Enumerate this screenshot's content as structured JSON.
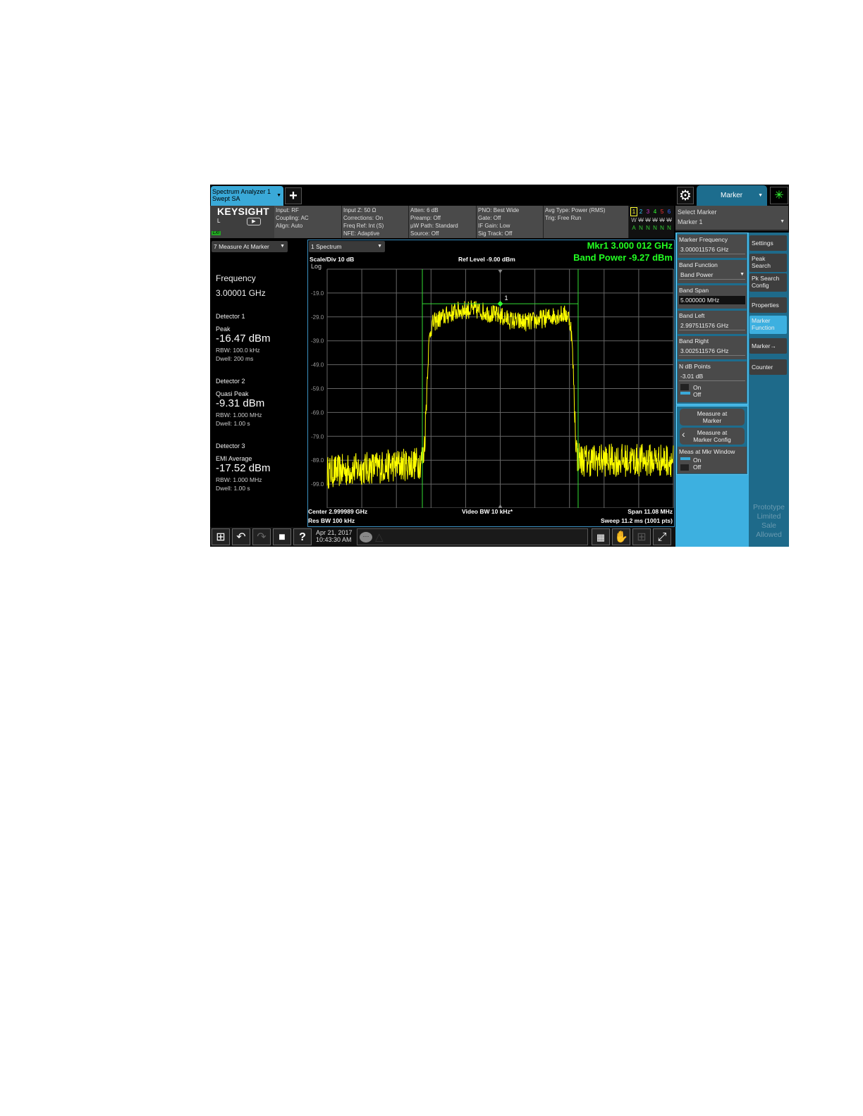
{
  "tabs": {
    "instrument_line1": "Spectrum Analyzer 1",
    "instrument_line2": "Swept SA",
    "add_icon": "plus-icon"
  },
  "menu": {
    "settings_icon": "gear-icon",
    "active_menu": "Marker",
    "status_icon": "busy-spinner-icon"
  },
  "brand": {
    "logo": "KEYSIGHT",
    "input_indicator": "L",
    "lxi": "LXI"
  },
  "settings": [
    [
      "Input: RF",
      "Coupling: AC",
      "Align: Auto",
      ""
    ],
    [
      "Input Z: 50 Ω",
      "Corrections: On",
      "Freq Ref: Int (S)",
      "NFE: Adaptive"
    ],
    [
      "Atten: 6 dB",
      "Preamp: Off",
      "µW Path: Standard",
      "Source: Off"
    ],
    [
      "PNO: Best Wide",
      "Gate: Off",
      "IF Gain: Low",
      "Sig Track: Off"
    ],
    [
      "Avg Type: Power (RMS)",
      "Trig: Free Run",
      "",
      ""
    ]
  ],
  "traces": {
    "numbers": [
      "1",
      "2",
      "3",
      "4",
      "5",
      "6"
    ],
    "colors": [
      "#ffff33",
      "#33ccff",
      "#cc33cc",
      "#33ff33",
      "#ff3333",
      "#3366ff"
    ],
    "types": [
      "W",
      "W",
      "W",
      "W",
      "W",
      "W"
    ],
    "detectors": [
      "A",
      "N",
      "N",
      "N",
      "N",
      "N"
    ]
  },
  "left_panel": {
    "window_label": "7 Measure At Marker",
    "freq_label": "Frequency",
    "freq_value": "3.00001 GHz",
    "detectors": [
      {
        "title": "Detector 1",
        "type": "Peak",
        "value": "-16.47 dBm",
        "rbw": "RBW: 100.0 kHz",
        "dwell": "Dwell: 200 ms"
      },
      {
        "title": "Detector 2",
        "type": "Quasi Peak",
        "value": "-9.31 dBm",
        "rbw": "RBW: 1.000 MHz",
        "dwell": "Dwell: 1.00 s"
      },
      {
        "title": "Detector 3",
        "type": "EMI Average",
        "value": "-17.52 dBm",
        "rbw": "RBW: 1.000 MHz",
        "dwell": "Dwell: 1.00 s"
      }
    ]
  },
  "spectrum": {
    "window_label": "1 Spectrum",
    "scale": "Scale/Div 10 dB",
    "scale_type": "Log",
    "ref_level": "Ref Level -9.00 dBm",
    "marker_readout": "Mkr1  3.000 012 GHz",
    "band_power": "Band Power  -9.27 dBm",
    "marker_label": "1",
    "y_ticks": [
      "-19.0",
      "-29.0",
      "-39.0",
      "-49.0",
      "-59.0",
      "-69.0",
      "-79.0",
      "-89.0",
      "-99.0"
    ],
    "center": "Center 2.999989 GHz",
    "res_bw": "Res BW 100 kHz",
    "video_bw": "Video BW 10 kHz*",
    "span": "Span 11.08 MHz",
    "sweep": "Sweep 11.2 ms  (1001 pts)"
  },
  "chart_data": {
    "type": "line",
    "ylim": [
      -109,
      -9
    ],
    "x_span_mhz": 11.08,
    "center_ghz": 2.999989,
    "noise_floor_dbm": -92,
    "band_top_dbm": -27,
    "band_edges_fraction": [
      0.275,
      0.725
    ],
    "band_line_dbm": -23.5,
    "marker_fraction": 0.5,
    "trace_color": "#ffff00",
    "band_color": "#33dd33"
  },
  "softkeys": {
    "select_marker_label": "Select Marker",
    "select_marker_value": "Marker 1",
    "marker_frequency_label": "Marker Frequency",
    "marker_frequency_value": "3.000011576 GHz",
    "band_function_label": "Band Function",
    "band_function_value": "Band Power",
    "band_span_label": "Band Span",
    "band_span_value": "5.000000 MHz",
    "band_left_label": "Band Left",
    "band_left_value": "2.997511576 GHz",
    "band_right_label": "Band Right",
    "band_right_value": "3.002511576 GHz",
    "ndb_label": "N dB Points",
    "ndb_value": "-3.01 dB",
    "on": "On",
    "off": "Off",
    "measure_at_marker": "Measure at Marker",
    "measure_config": "Measure at Marker Config",
    "meas_window_label": "Meas at Mkr Window"
  },
  "menu_buttons": [
    "Settings",
    "Peak Search",
    "Pk Search Config",
    "Properties",
    "Marker Function",
    "Marker→",
    "Counter"
  ],
  "watermark": "Prototype Limited Sale Allowed",
  "taskbar": {
    "date": "Apr 21, 2017",
    "time": "10:43:30 AM"
  }
}
